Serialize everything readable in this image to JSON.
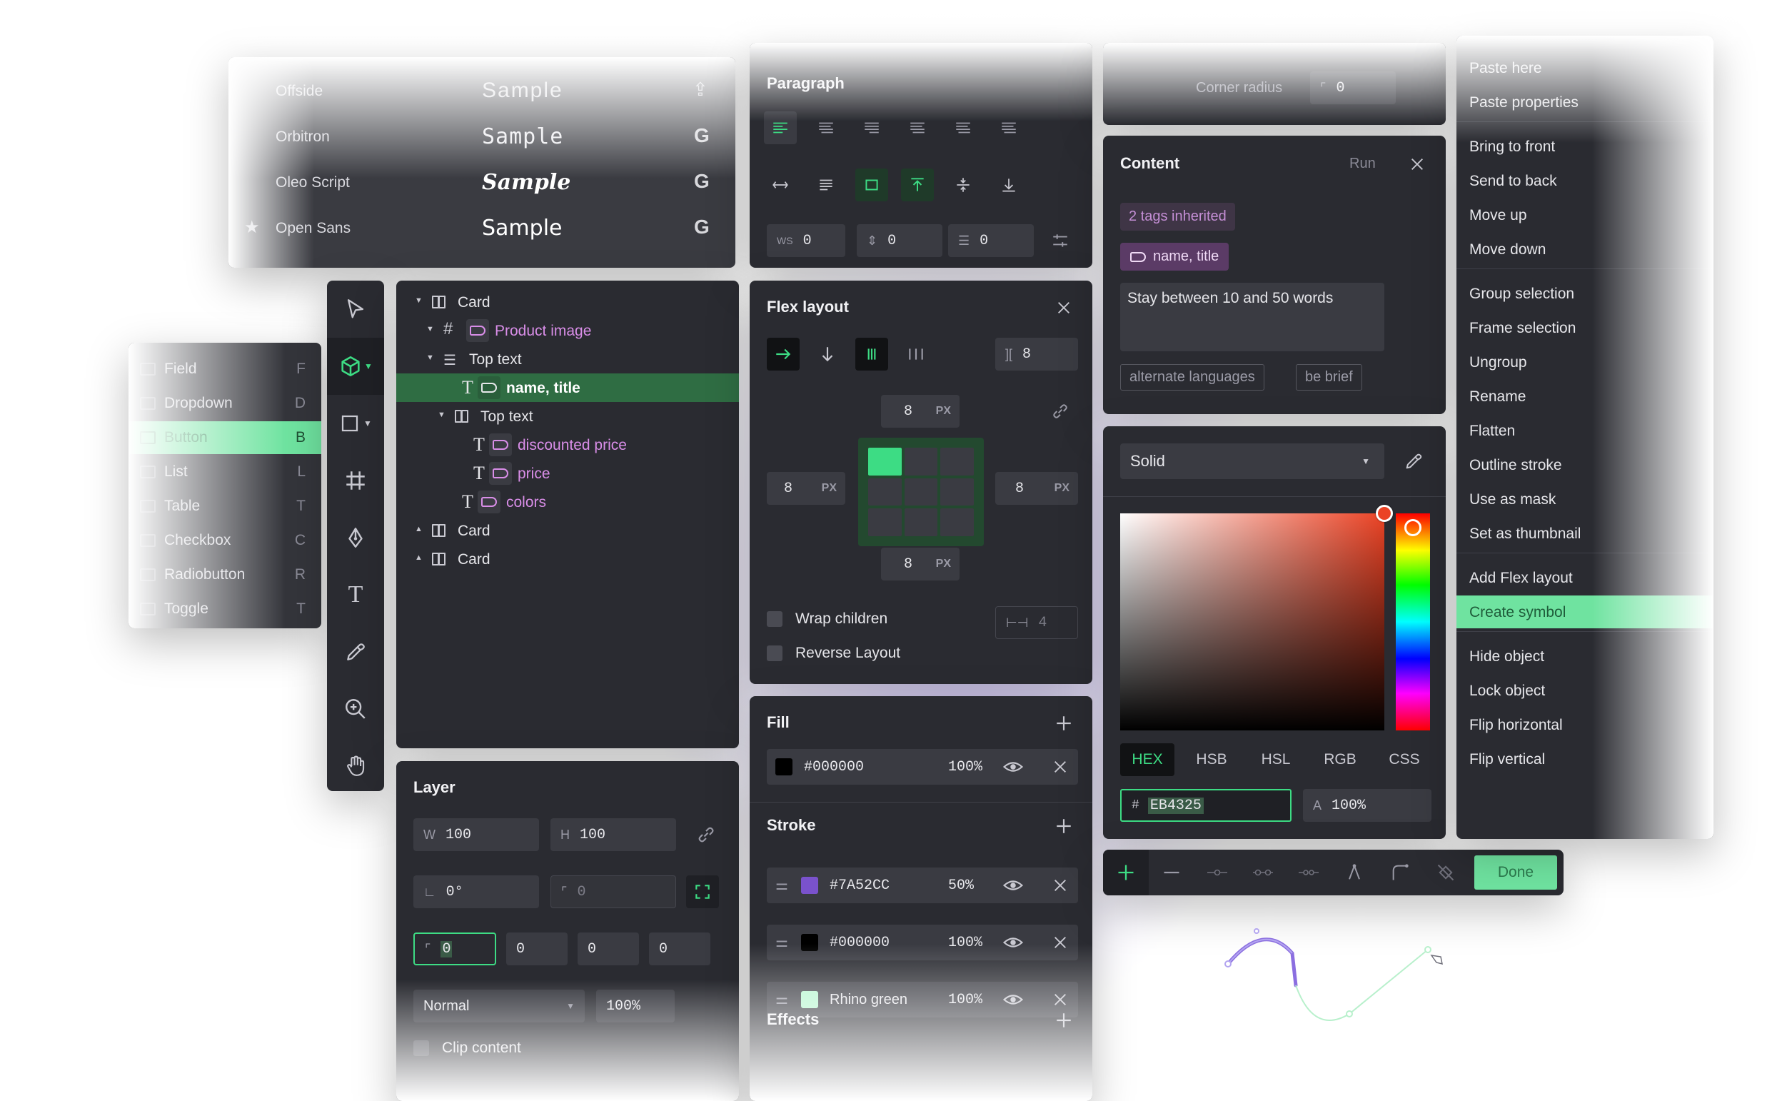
{
  "fonts_panel": {
    "items": [
      {
        "name": "Offside",
        "sample": "Sample"
      },
      {
        "name": "Orbitron",
        "sample": "Sample"
      },
      {
        "name": "Oleo Script",
        "sample": "Sample"
      },
      {
        "name": "Open Sans",
        "sample": "Sample"
      }
    ],
    "google_glyph": "G"
  },
  "components_panel": {
    "items": [
      {
        "label": "Field",
        "key": "F"
      },
      {
        "label": "Dropdown",
        "key": "D"
      },
      {
        "label": "Button",
        "key": "B"
      },
      {
        "label": "List",
        "key": "L"
      },
      {
        "label": "Table",
        "key": "T"
      },
      {
        "label": "Checkbox",
        "key": "C"
      },
      {
        "label": "Radiobutton",
        "key": "R"
      },
      {
        "label": "Toggle",
        "key": "T"
      }
    ]
  },
  "layers_panel": {
    "rows": [
      {
        "label": "Card"
      },
      {
        "label": "Product image"
      },
      {
        "label": "Top text"
      },
      {
        "label": "name, title"
      },
      {
        "label": "Top text"
      },
      {
        "label": "discounted price"
      },
      {
        "label": "price"
      },
      {
        "label": "colors"
      },
      {
        "label": "Card"
      },
      {
        "label": "Card"
      }
    ]
  },
  "layer_panel": {
    "title": "Layer",
    "w_label": "W",
    "w": "100",
    "h_label": "H",
    "h": "100",
    "rotation": "0°",
    "corner": "0",
    "radius": [
      "0",
      "0",
      "0",
      "0"
    ],
    "blend": "Normal",
    "opacity": "100%",
    "clip": "Clip content"
  },
  "paragraph_panel": {
    "title": "Paragraph",
    "ws_label": "WS",
    "ws": "0",
    "line": "0",
    "para": "0"
  },
  "flex_panel": {
    "title": "Flex layout",
    "gap": "8",
    "padding_top": "8",
    "padding_left": "8",
    "padding_right": "8",
    "padding_bottom": "8",
    "unit": "PX",
    "wrap": "Wrap children",
    "wrap_gap": "4",
    "reverse": "Reverse Layout"
  },
  "fill_panel": {
    "title": "Fill",
    "items": [
      {
        "value": "#000000",
        "opacity": "100%",
        "swatch": "#000000"
      }
    ]
  },
  "stroke_panel": {
    "title": "Stroke",
    "items": [
      {
        "value": "#7A52CC",
        "opacity": "50%",
        "swatch": "#7A52CC"
      },
      {
        "value": "#000000",
        "opacity": "100%",
        "swatch": "#000000"
      },
      {
        "value": "Rhino green",
        "opacity": "100%",
        "swatch": "#b6f5cf"
      }
    ],
    "effects_title": "Effects"
  },
  "corner_panel": {
    "label": "Corner radius",
    "value": "0"
  },
  "content_panel": {
    "title": "Content",
    "run": "Run",
    "inherited": "2 tags inherited",
    "tag": "name, title",
    "prompt": "Stay between 10 and 50 words",
    "chips": [
      "alternate languages",
      "be brief"
    ]
  },
  "color_panel": {
    "mode": "Solid",
    "tabs": [
      "HEX",
      "HSB",
      "HSL",
      "RGB",
      "CSS"
    ],
    "hash": "#",
    "hex": "EB4325",
    "alpha_label": "A",
    "alpha": "100%",
    "accent": "#3ddc84",
    "picked": "#EB4325"
  },
  "context_menu": {
    "groups": [
      [
        "Paste here",
        "Paste properties"
      ],
      [
        "Bring to front",
        "Send to back",
        "Move up",
        "Move down"
      ],
      [
        "Group selection",
        "Frame selection",
        "Ungroup",
        "Rename",
        "Flatten",
        "Outline stroke",
        "Use as mask",
        "Set as thumbnail"
      ],
      [
        "Add Flex layout",
        "Create symbol"
      ],
      [
        "Hide object",
        "Lock object",
        "Flip horizontal",
        "Flip vertical"
      ]
    ]
  },
  "path_toolbar": {
    "done": "Done"
  }
}
